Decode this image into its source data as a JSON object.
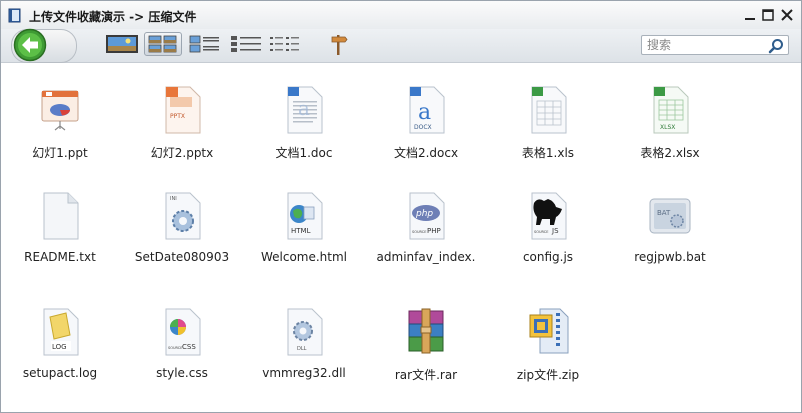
{
  "window": {
    "title": "上传文件收藏演示 -> 压缩文件",
    "minimize_icon": "minimize-icon",
    "maximize_icon": "maximize-icon",
    "close_icon": "close-icon"
  },
  "toolbar": {
    "back_icon": "back-arrow-icon",
    "views": [
      "filmstrip-view-icon",
      "large-icons-view-icon",
      "tiles-view-icon",
      "details-view-icon",
      "list-view-icon"
    ],
    "settings_icon": "signpost-icon"
  },
  "search": {
    "placeholder": "搜索",
    "icon": "magnifier-icon"
  },
  "files": [
    {
      "name": "幻灯1.ppt",
      "type": "ppt"
    },
    {
      "name": "幻灯2.pptx",
      "type": "pptx"
    },
    {
      "name": "文档1.doc",
      "type": "doc"
    },
    {
      "name": "文档2.docx",
      "type": "docx"
    },
    {
      "name": "表格1.xls",
      "type": "xls"
    },
    {
      "name": "表格2.xlsx",
      "type": "xlsx"
    },
    {
      "name": "README.txt",
      "type": "txt"
    },
    {
      "name": "SetDate080903",
      "type": "ini"
    },
    {
      "name": "Welcome.html",
      "type": "html"
    },
    {
      "name": "adminfav_index.",
      "type": "php"
    },
    {
      "name": "config.js",
      "type": "js"
    },
    {
      "name": "regjpwb.bat",
      "type": "bat"
    },
    {
      "name": "setupact.log",
      "type": "log"
    },
    {
      "name": "style.css",
      "type": "css"
    },
    {
      "name": "vmmreg32.dll",
      "type": "dll"
    },
    {
      "name": "rar文件.rar",
      "type": "rar"
    },
    {
      "name": "zip文件.zip",
      "type": "zip"
    }
  ],
  "icon_badges": {
    "pptx": "PPTX",
    "docx": "DOCX",
    "xlsx": "XLSX",
    "ini": "INI",
    "html": "HTML",
    "php_logo": "php",
    "php": "PHP",
    "js": "JS",
    "bat": "BAT",
    "log": "LOG",
    "css": "CSS",
    "dll": "DLL",
    "source": "SOURCE"
  }
}
